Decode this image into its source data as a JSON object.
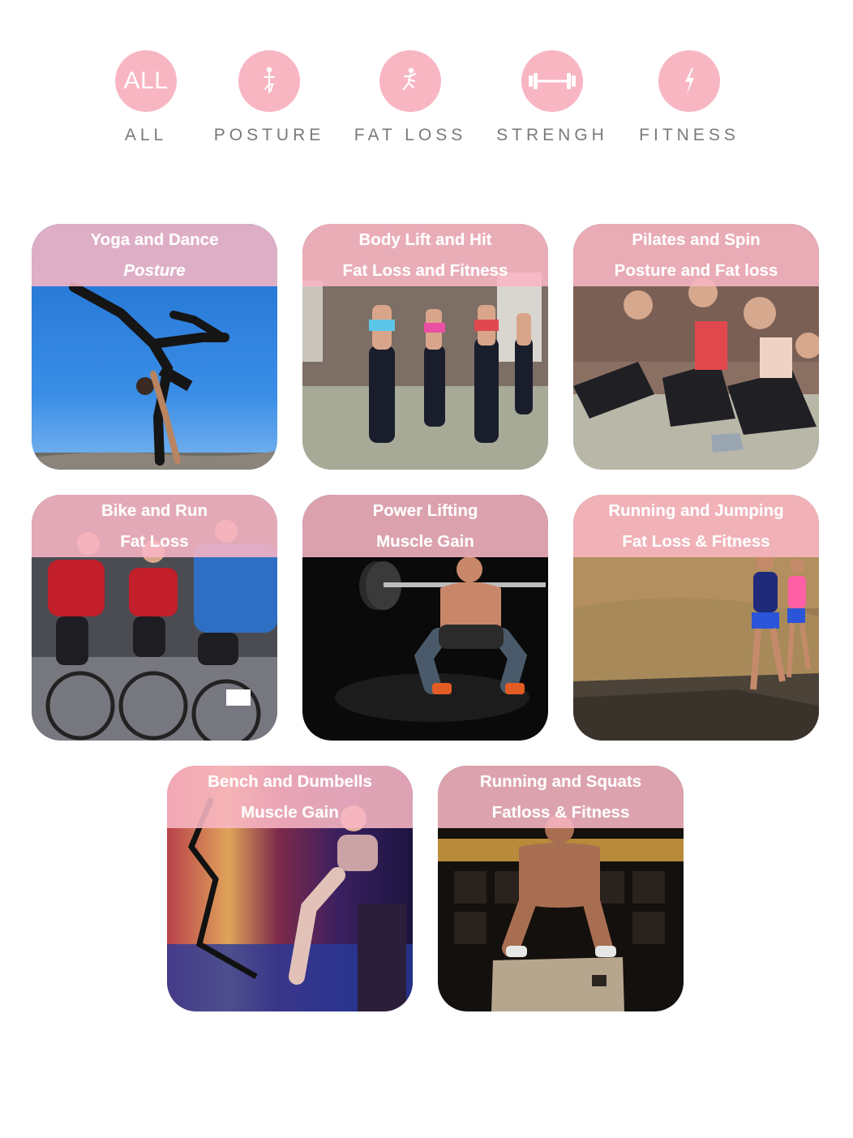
{
  "filters": [
    {
      "label": "ALL",
      "circle_text": "ALL",
      "icon": "all-text"
    },
    {
      "label": "POSTURE",
      "icon": "posture-figure-icon"
    },
    {
      "label": "FAT LOSS",
      "icon": "running-figure-icon"
    },
    {
      "label": "STRENGH",
      "icon": "barbell-icon"
    },
    {
      "label": "FITNESS",
      "icon": "lightning-bolt-icon"
    }
  ],
  "cards": [
    {
      "title": "Yoga and Dance",
      "subtitle": "Posture",
      "image": "yoga-handstand-beach"
    },
    {
      "title": "Body Lift and Hit",
      "subtitle": "Fat Loss and Fitness",
      "image": "women-dumbbell-class"
    },
    {
      "title": "Pilates and Spin",
      "subtitle": "Posture and Fat loss",
      "image": "women-sitting-gym-floor"
    },
    {
      "title": "Bike and Run",
      "subtitle": "Fat Loss",
      "image": "cyclists-racing"
    },
    {
      "title": "Power Lifting",
      "subtitle": "Muscle Gain",
      "image": "barbell-squat-dark"
    },
    {
      "title": "Running and Jumping",
      "subtitle": "Fat Loss & Fitness",
      "image": "trail-runners"
    },
    {
      "title": "Bench and Dumbells",
      "subtitle": "Muscle Gain",
      "image": "woman-dumbbell-curl"
    },
    {
      "title": "Running and Squats",
      "subtitle": "Fatloss & Fitness",
      "image": "box-jump-gym"
    }
  ],
  "colors": {
    "accent_pink": "#f8b6c3",
    "label_gray": "#7a7a7a",
    "banner_text": "#ffffff"
  }
}
